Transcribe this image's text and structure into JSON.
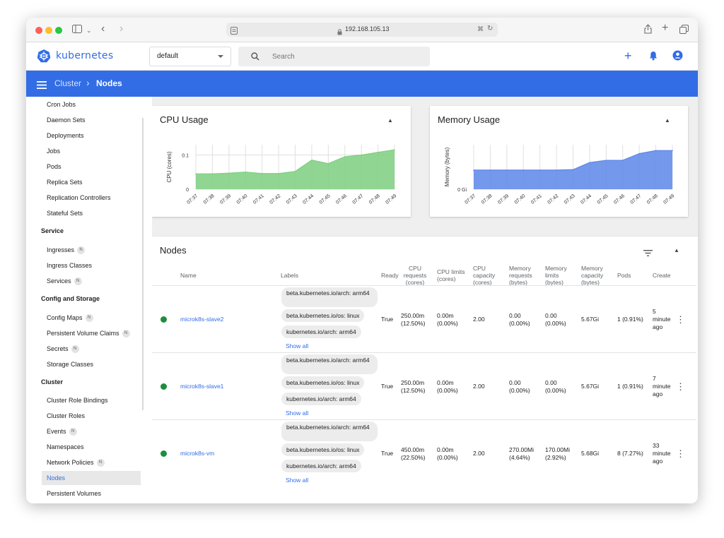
{
  "browser": {
    "address": "192.168.105.13"
  },
  "app": {
    "logo_text": "kubernetes",
    "namespace": "default",
    "search_placeholder": "Search"
  },
  "breadcrumb": {
    "parent": "Cluster",
    "separator": "›",
    "current": "Nodes"
  },
  "sidebar": {
    "items_top": [
      {
        "label": "Cron Jobs"
      },
      {
        "label": "Daemon Sets"
      },
      {
        "label": "Deployments"
      },
      {
        "label": "Jobs"
      },
      {
        "label": "Pods"
      },
      {
        "label": "Replica Sets"
      },
      {
        "label": "Replication Controllers"
      },
      {
        "label": "Stateful Sets"
      }
    ],
    "service_header": "Service",
    "service_items": [
      {
        "label": "Ingresses",
        "badge": "N"
      },
      {
        "label": "Ingress Classes"
      },
      {
        "label": "Services",
        "badge": "N"
      }
    ],
    "config_header": "Config and Storage",
    "config_items": [
      {
        "label": "Config Maps",
        "badge": "N"
      },
      {
        "label": "Persistent Volume Claims",
        "badge": "N"
      },
      {
        "label": "Secrets",
        "badge": "N"
      },
      {
        "label": "Storage Classes"
      }
    ],
    "cluster_header": "Cluster",
    "cluster_items": [
      {
        "label": "Cluster Role Bindings"
      },
      {
        "label": "Cluster Roles"
      },
      {
        "label": "Events",
        "badge": "N"
      },
      {
        "label": "Namespaces"
      },
      {
        "label": "Network Policies",
        "badge": "N"
      },
      {
        "label": "Nodes",
        "active": true
      },
      {
        "label": "Persistent Volumes"
      }
    ]
  },
  "cpu_card": {
    "title": "CPU Usage"
  },
  "mem_card": {
    "title": "Memory Usage"
  },
  "chart_data": [
    {
      "type": "area",
      "title": "CPU Usage",
      "ylabel": "CPU (cores)",
      "x": [
        "07:37",
        "07:38",
        "07:39",
        "07:40",
        "07:41",
        "07:42",
        "07:43",
        "07:44",
        "07:45",
        "07:46",
        "07:47",
        "07:48",
        "07:49"
      ],
      "values": [
        0.045,
        0.045,
        0.047,
        0.05,
        0.046,
        0.046,
        0.052,
        0.085,
        0.075,
        0.095,
        0.1,
        0.108,
        0.115
      ],
      "ylim": [
        0,
        0.13
      ],
      "yticks": [
        {
          "value": 0,
          "label": "0"
        },
        {
          "value": 0.1,
          "label": "0.1"
        }
      ],
      "color": "#7ccf7f"
    },
    {
      "type": "area",
      "title": "Memory Usage",
      "ylabel": "Memory (bytes)",
      "x": [
        "07:37",
        "07:38",
        "07:39",
        "07:40",
        "07:41",
        "07:42",
        "07:43",
        "07:44",
        "07:45",
        "07:46",
        "07:47",
        "07:48",
        "07:49"
      ],
      "values": [
        0.43,
        0.43,
        0.43,
        0.43,
        0.43,
        0.43,
        0.44,
        0.6,
        0.65,
        0.65,
        0.8,
        0.87,
        0.87
      ],
      "ylim": [
        0,
        1.0
      ],
      "yticks": [
        {
          "value": 0,
          "label": "0 Gi"
        }
      ],
      "color": "#5c86e8"
    }
  ],
  "nodes": {
    "title": "Nodes",
    "headers": {
      "name": "Name",
      "labels": "Labels",
      "ready": "Ready",
      "cpu_req": "CPU requests (cores)",
      "cpu_lim": "CPU limits (cores)",
      "cpu_cap": "CPU capacity (cores)",
      "mem_req": "Memory requests (bytes)",
      "mem_lim": "Memory limits (bytes)",
      "mem_cap": "Memory capacity (bytes)",
      "pods": "Pods",
      "created": "Create"
    },
    "rows": [
      {
        "name": "microk8s-slave2",
        "label1": "beta.kubernetes.io/arch: arm64",
        "label2": "beta.kubernetes.io/os: linux",
        "label3": "kubernetes.io/arch: arm64",
        "show_all": "Show all",
        "ready": "True",
        "cpu_req": "250.00m (12.50%)",
        "cpu_lim": "0.00m (0.00%)",
        "cpu_cap": "2.00",
        "mem_req": "0.00 (0.00%)",
        "mem_lim": "0.00 (0.00%)",
        "mem_cap": "5.67Gi",
        "pods": "1 (0.91%)",
        "created": "5 minute ago"
      },
      {
        "name": "microk8s-slave1",
        "label1": "beta.kubernetes.io/arch: arm64",
        "label2": "beta.kubernetes.io/os: linux",
        "label3": "kubernetes.io/arch: arm64",
        "show_all": "Show all",
        "ready": "True",
        "cpu_req": "250.00m (12.50%)",
        "cpu_lim": "0.00m (0.00%)",
        "cpu_cap": "2.00",
        "mem_req": "0.00 (0.00%)",
        "mem_lim": "0.00 (0.00%)",
        "mem_cap": "5.67Gi",
        "pods": "1 (0.91%)",
        "created": "7 minute ago"
      },
      {
        "name": "microk8s-vm",
        "label1": "beta.kubernetes.io/arch: arm64",
        "label2": "beta.kubernetes.io/os: linux",
        "label3": "kubernetes.io/arch: arm64",
        "show_all": "Show all",
        "ready": "True",
        "cpu_req": "450.00m (22.50%)",
        "cpu_lim": "0.00m (0.00%)",
        "cpu_cap": "2.00",
        "mem_req": "270.00Mi (4.64%)",
        "mem_lim": "170.00Mi (2.92%)",
        "mem_cap": "5.68Gi",
        "pods": "8 (7.27%)",
        "created": "33 minute ago"
      }
    ]
  }
}
